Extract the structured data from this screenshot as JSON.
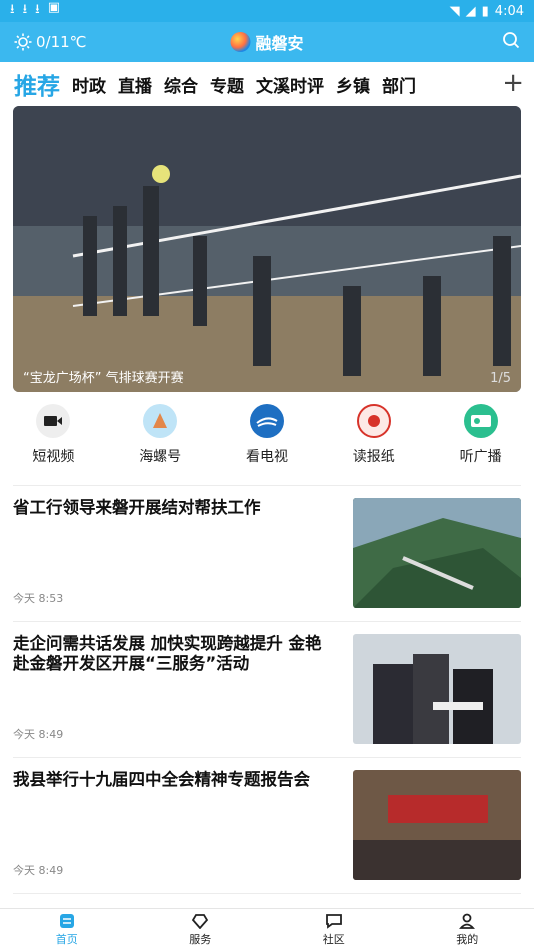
{
  "statusbar": {
    "time": "4:04"
  },
  "header": {
    "weather": "0/11℃",
    "app_name": "融磐安"
  },
  "tabs": [
    "推荐",
    "时政",
    "直播",
    "综合",
    "专题",
    "文溪时评",
    "乡镇",
    "部门"
  ],
  "banner": {
    "caption": "“宝龙广场杯” 气排球赛开赛",
    "index": "1/5"
  },
  "shortcuts": [
    {
      "label": "短视频",
      "icon": "video-camera-icon"
    },
    {
      "label": "海螺号",
      "icon": "conch-icon"
    },
    {
      "label": "看电视",
      "icon": "tv-icon"
    },
    {
      "label": "读报纸",
      "icon": "newspaper-icon"
    },
    {
      "label": "听广播",
      "icon": "radio-icon"
    }
  ],
  "news": [
    {
      "title": "省工行领导来磐开展结对帮扶工作",
      "time": "今天 8:53"
    },
    {
      "title": "走企问需共话发展 加快实现跨越提升 金艳赴金磐开发区开展“三服务”活动",
      "time": "今天 8:49"
    },
    {
      "title": "我县举行十九届四中全会精神专题报告会",
      "time": "今天 8:49"
    }
  ],
  "nav": [
    {
      "label": "首页",
      "icon": "home-icon"
    },
    {
      "label": "服务",
      "icon": "service-icon"
    },
    {
      "label": "社区",
      "icon": "community-icon"
    },
    {
      "label": "我的",
      "icon": "profile-icon"
    }
  ],
  "colors": {
    "accent": "#27a6e5",
    "header": "#3bb8ef"
  }
}
